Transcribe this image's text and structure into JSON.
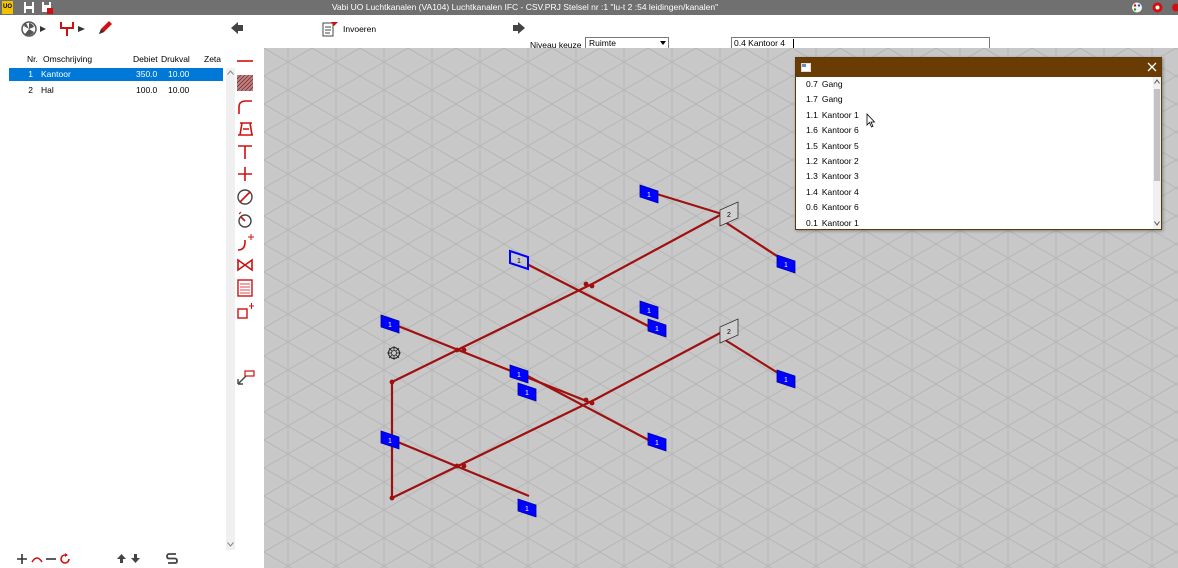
{
  "app": {
    "title": "Vabi UO Luchtkanalen (VA104)  Luchtkanalen IFC - CSV.PRJ     Stelsel nr   :1  \"lu-t 2 :54 leidingen/kanalen\"",
    "logo_text": "UO"
  },
  "toolbar": {
    "invoeren_label": "Invoeren",
    "niveau_label": "Niveau keuze",
    "niveau_value": "Ruimte",
    "room_value": "0.4  Kantoor 4"
  },
  "table": {
    "headers": {
      "nr": "Nr.",
      "omschrijving": "Omschrijving",
      "debiet": "Debiet",
      "drukval": "Drukval",
      "zeta": "Zeta"
    },
    "rows": [
      {
        "nr": "1",
        "omschrijving": "Kantoor",
        "debiet": "350.0",
        "drukval": "10.00",
        "zeta": "",
        "selected": true
      },
      {
        "nr": "2",
        "omschrijving": "Hal",
        "debiet": "100.0",
        "drukval": "10.00",
        "zeta": "",
        "selected": false
      }
    ]
  },
  "popup": {
    "items": [
      {
        "code": "0.7",
        "name": "Gang"
      },
      {
        "code": "1.7",
        "name": "Gang"
      },
      {
        "code": "1.1",
        "name": "Kantoor 1"
      },
      {
        "code": "1.6",
        "name": "Kantoor 6"
      },
      {
        "code": "1.5",
        "name": "Kantoor 5"
      },
      {
        "code": "1.2",
        "name": "Kantoor 2"
      },
      {
        "code": "1.3",
        "name": "Kantoor 3"
      },
      {
        "code": "1.4",
        "name": "Kantoor 4"
      },
      {
        "code": "0.6",
        "name": "Kantoor 6"
      },
      {
        "code": "0.1",
        "name": "Kantoor 1"
      }
    ]
  },
  "drawing": {
    "colors": {
      "duct": "#a01010",
      "terminal": "#0000ff",
      "grid": "#b4b4b4",
      "background": "#c8c8c8",
      "selection": "#0078d7",
      "popup_header": "#6b3b04"
    },
    "terminal_labels": {
      "supply": "1",
      "exhaust": "2"
    }
  }
}
